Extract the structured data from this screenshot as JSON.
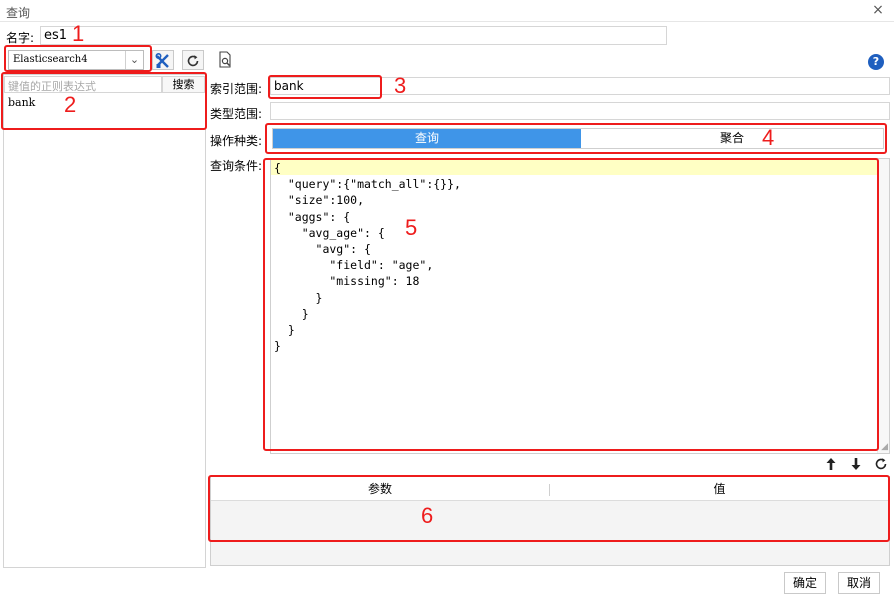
{
  "window": {
    "title": "查询",
    "close_glyph": "×"
  },
  "name": {
    "label": "名字:",
    "value": "es1"
  },
  "connection": {
    "selected": "Elasticsearch4"
  },
  "toolbar": {
    "tool_icon": "tools-icon",
    "refresh_icon": "refresh-icon",
    "preview_icon": "document-search-icon"
  },
  "help": {
    "glyph": "?"
  },
  "left": {
    "search_placeholder": "键值的正则表达式",
    "search_button": "搜索",
    "items": [
      "bank"
    ]
  },
  "form": {
    "index_label": "索引范围:",
    "index_value": "bank",
    "type_label": "类型范围:",
    "type_value": "",
    "op_label": "操作种类:",
    "op_query": "查询",
    "op_agg": "聚合",
    "cond_label": "查询条件:"
  },
  "editor": {
    "code": "{\n  \"query\":{\"match_all\":{}},\n  \"size\":100,\n  \"aggs\": {\n    \"avg_age\": {\n      \"avg\": {\n        \"field\": \"age\",\n        \"missing\": 18\n      }\n    }\n  }\n}"
  },
  "params": {
    "col_param": "参数",
    "col_value": "值"
  },
  "buttons": {
    "ok": "确定",
    "cancel": "取消"
  },
  "annotations": [
    "1",
    "2",
    "3",
    "4",
    "5",
    "6"
  ],
  "colors": {
    "accent": "#3f95e8",
    "annotation_red": "#ee1c1c",
    "highlight_line": "#ffffc4"
  }
}
